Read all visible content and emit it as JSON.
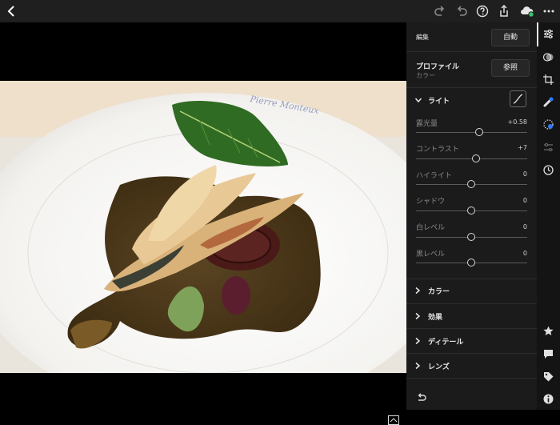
{
  "colors": {
    "accent": "#2f7cf6",
    "panel": "#1b1b1b",
    "topbar": "#1f1f1f",
    "cloud_badge": "#3ac46b"
  },
  "topbar": {
    "icons": [
      "back-icon",
      "redo-icon",
      "undo-icon",
      "help-icon",
      "share-icon",
      "cloud-sync-icon",
      "more-icon"
    ]
  },
  "panel": {
    "edit_label": "編集",
    "auto_label": "自動",
    "profile_title": "プロファイル",
    "profile_value": "カラー",
    "browse_label": "参照",
    "light": {
      "title": "ライト",
      "curve_icon": "tone-curve-icon",
      "sliders": [
        {
          "name": "露光量",
          "value": "+0.58",
          "level": 0.579
        },
        {
          "name": "コントラスト",
          "value": "+7",
          "level": 0.54
        },
        {
          "name": "ハイライト",
          "value": "0",
          "level": 0.5
        },
        {
          "name": "シャドウ",
          "value": "0",
          "level": 0.5
        },
        {
          "name": "白レベル",
          "value": "0",
          "level": 0.5
        },
        {
          "name": "黒レベル",
          "value": "0",
          "level": 0.5
        }
      ]
    },
    "sections": [
      "カラー",
      "効果",
      "ディテール",
      "レンズ"
    ]
  },
  "rail": {
    "icons": [
      "adjust-sliders-icon",
      "presets-icon",
      "crop-icon",
      "healing-icon",
      "masking-icon",
      "versions-icon",
      "history-icon",
      "rating-star-icon",
      "comment-icon",
      "tag-icon",
      "info-icon"
    ]
  }
}
